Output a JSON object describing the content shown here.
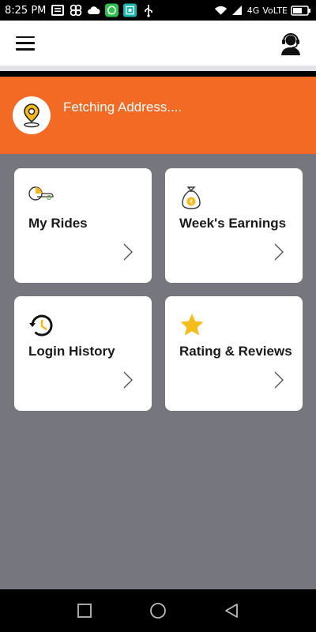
{
  "status_bar": {
    "time": "8:25 PM",
    "network": "4G",
    "volte": "VoLTE",
    "left_icons": [
      "message-icon",
      "pinwheel-icon",
      "cloud-icon",
      "whatsapp-icon",
      "scanner-icon",
      "usb-icon"
    ],
    "right_icons": [
      "wifi-icon",
      "signal-icon",
      "battery-icon"
    ]
  },
  "app_bar": {
    "menu_icon": "hamburger-menu-icon",
    "support_icon": "customer-support-icon"
  },
  "location": {
    "icon": "location-pin-icon",
    "text": "Fetching Address....",
    "background": "#f36a24"
  },
  "cards": [
    {
      "label": "My Rides",
      "icon": "rides-icon"
    },
    {
      "label": "Week's Earnings",
      "icon": "money-bag-icon"
    },
    {
      "label": "Login History",
      "icon": "history-icon"
    },
    {
      "label": "Rating & Reviews",
      "icon": "star-icon"
    }
  ],
  "nav_bar": {
    "buttons": [
      "recent-apps-icon",
      "home-icon",
      "back-icon"
    ]
  },
  "colors": {
    "accent": "#f36a24",
    "content_bg": "#76767e",
    "star": "#f4bd1b",
    "pin": "#f6b81c"
  }
}
